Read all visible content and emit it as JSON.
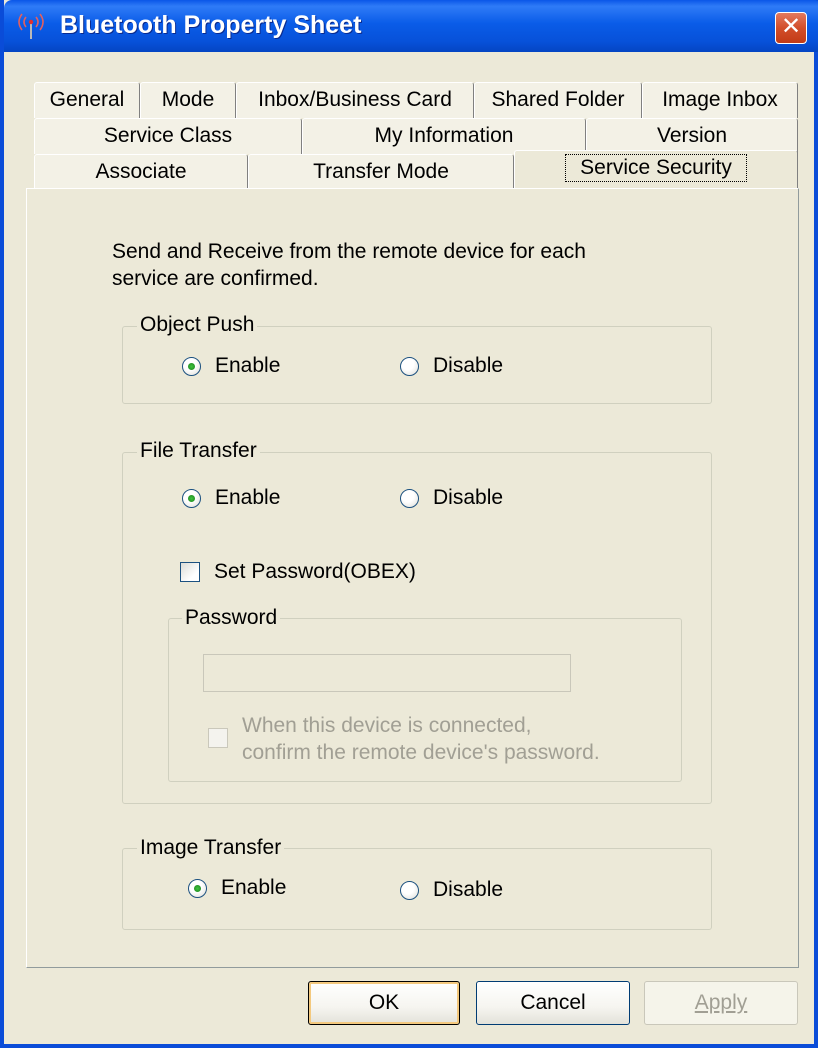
{
  "window": {
    "title": "Bluetooth Property Sheet",
    "close_label": "✕",
    "accent_color": "#0A56E8"
  },
  "tabs": {
    "row1": [
      "General",
      "Mode",
      "Inbox/Business Card",
      "Shared Folder",
      "Image Inbox"
    ],
    "row2": [
      "Service Class",
      "My Information",
      "Version"
    ],
    "row3": [
      "Associate",
      "Transfer Mode",
      "Service Security"
    ],
    "selected": "Service Security"
  },
  "content": {
    "description_line1": "Send and Receive from the remote device for each",
    "description_line2": "service are confirmed."
  },
  "object_push": {
    "legend": "Object Push",
    "enable_label": "Enable",
    "disable_label": "Disable",
    "selected": "Enable"
  },
  "file_transfer": {
    "legend": "File Transfer",
    "enable_label": "Enable",
    "disable_label": "Disable",
    "selected": "Enable",
    "set_password_label": "Set Password(OBEX)",
    "set_password_checked": false,
    "password": {
      "legend": "Password",
      "value": "",
      "confirm_line1": "When this device is connected,",
      "confirm_line2": "confirm the remote device's password.",
      "confirm_checked": false
    }
  },
  "image_transfer": {
    "legend": "Image Transfer",
    "enable_label": "Enable",
    "disable_label": "Disable",
    "selected": "Enable"
  },
  "buttons": {
    "ok": "OK",
    "cancel": "Cancel",
    "apply": "Apply"
  }
}
